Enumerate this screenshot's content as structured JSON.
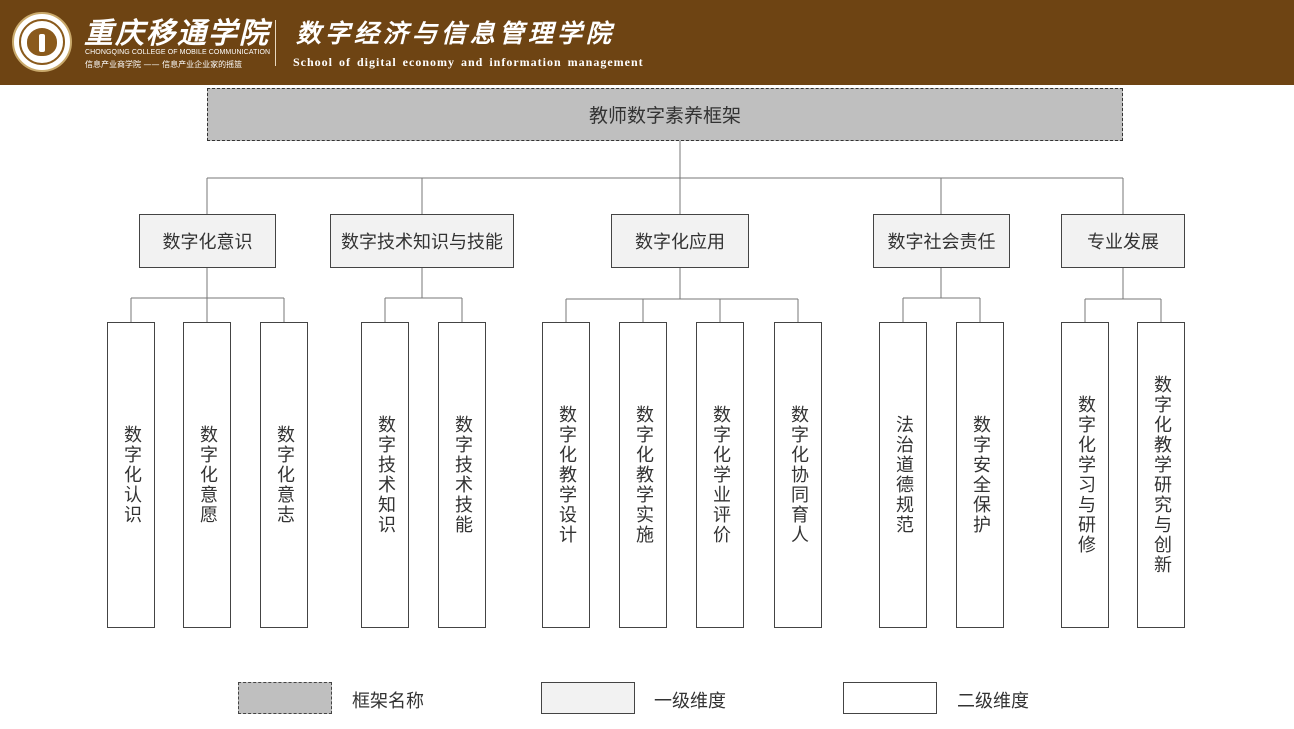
{
  "header": {
    "college_name_cn": "重庆移通学院",
    "college_name_en": "CHONGQING COLLEGE OF MOBILE COMMUNICATION",
    "college_slogan": "信息产业商学院 —— 信息产业企业家的摇篮",
    "school_name_cn": "数字经济与信息管理学院",
    "school_name_en": "School of digital economy and information management"
  },
  "diagram": {
    "root": "教师数字素养框架",
    "dimensions": [
      {
        "label": "数字化意识",
        "children": [
          "数字化认识",
          "数字化意愿",
          "数字化意志"
        ]
      },
      {
        "label": "数字技术知识与技能",
        "children": [
          "数字技术知识",
          "数字技术技能"
        ]
      },
      {
        "label": "数字化应用",
        "children": [
          "数字化教学设计",
          "数字化教学实施",
          "数字化学业评价",
          "数字化协同育人"
        ]
      },
      {
        "label": "数字社会责任",
        "children": [
          "法治道德规范",
          "数字安全保护"
        ]
      },
      {
        "label": "专业发展",
        "children": [
          "数字化学习与研修",
          "数字化教学研究与创新"
        ]
      }
    ]
  },
  "legend": [
    {
      "label": "框架名称",
      "fill": "#bfbfbf"
    },
    {
      "label": "一级维度",
      "fill": "#f2f2f2"
    },
    {
      "label": "二级维度",
      "fill": "#ffffff"
    }
  ],
  "colors": {
    "header_bg": "#6e4413",
    "line": "#777777"
  }
}
